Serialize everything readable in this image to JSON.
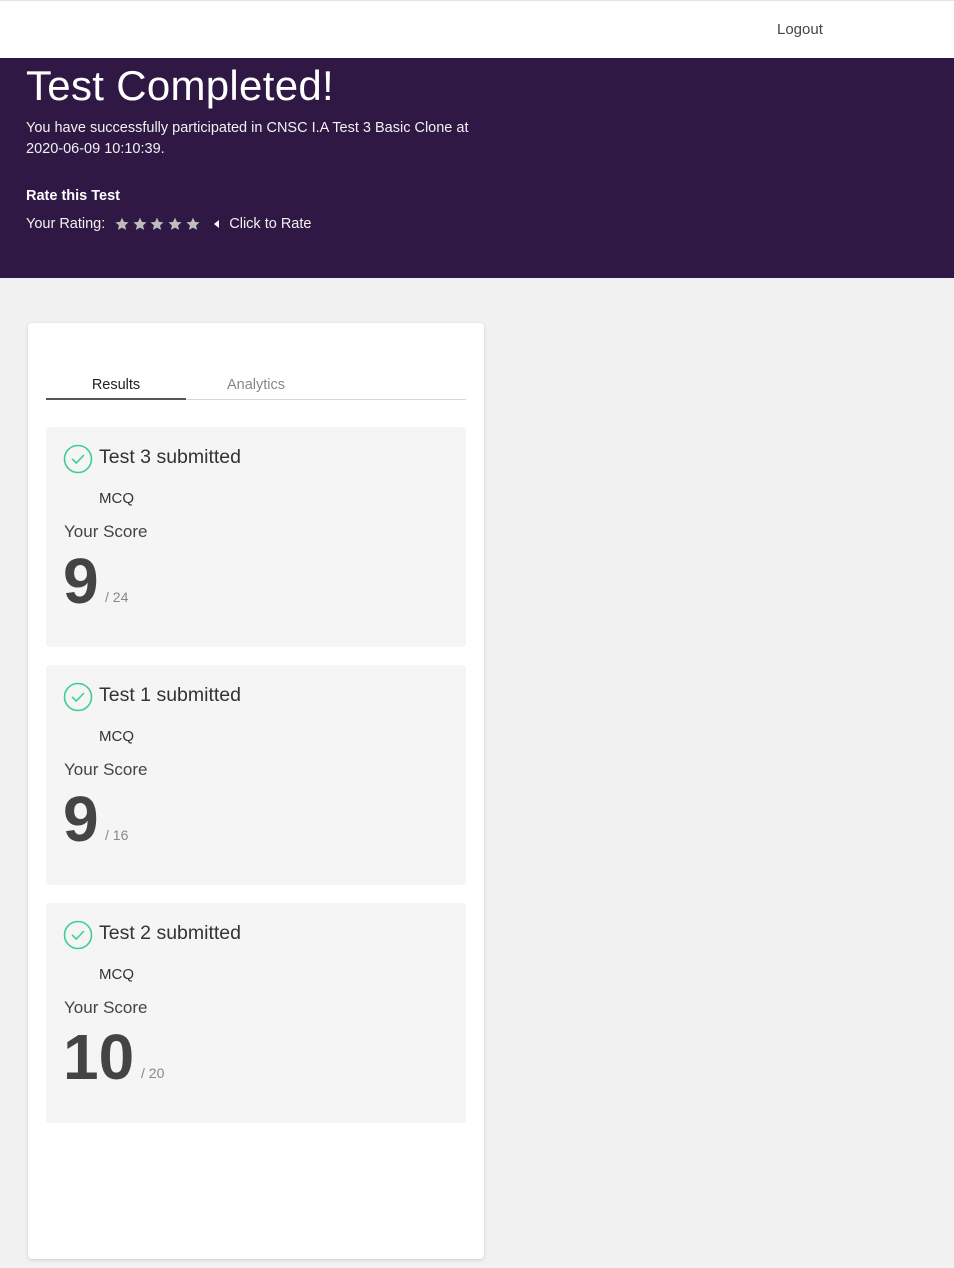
{
  "header": {
    "logout_label": "Logout"
  },
  "hero": {
    "title": "Test Completed!",
    "description": "You have successfully participated in CNSC I.A Test 3 Basic Clone at 2020-06-09 10:10:39.",
    "rate_heading": "Rate this Test",
    "rating_label": "Your Rating:",
    "rating_stars_filled": 0,
    "rating_stars_total": 5,
    "click_to_rate": "Click to Rate"
  },
  "tabs": [
    {
      "label": "Results",
      "active": true
    },
    {
      "label": "Analytics",
      "active": false
    }
  ],
  "results": [
    {
      "title": "Test 3 submitted",
      "type": "MCQ",
      "score_label": "Your Score",
      "score": "9",
      "total": "/ 24"
    },
    {
      "title": "Test 1 submitted",
      "type": "MCQ",
      "score_label": "Your Score",
      "score": "9",
      "total": "/ 16"
    },
    {
      "title": "Test 2 submitted",
      "type": "MCQ",
      "score_label": "Your Score",
      "score": "10",
      "total": "/ 20"
    }
  ],
  "colors": {
    "hero_bg": "#2f1944",
    "check_green": "#3dcf8e",
    "star_gray": "#bdbdbd"
  },
  "icons": {
    "star": "star-icon",
    "caret": "caret-left-icon",
    "check": "check-circle-icon"
  }
}
